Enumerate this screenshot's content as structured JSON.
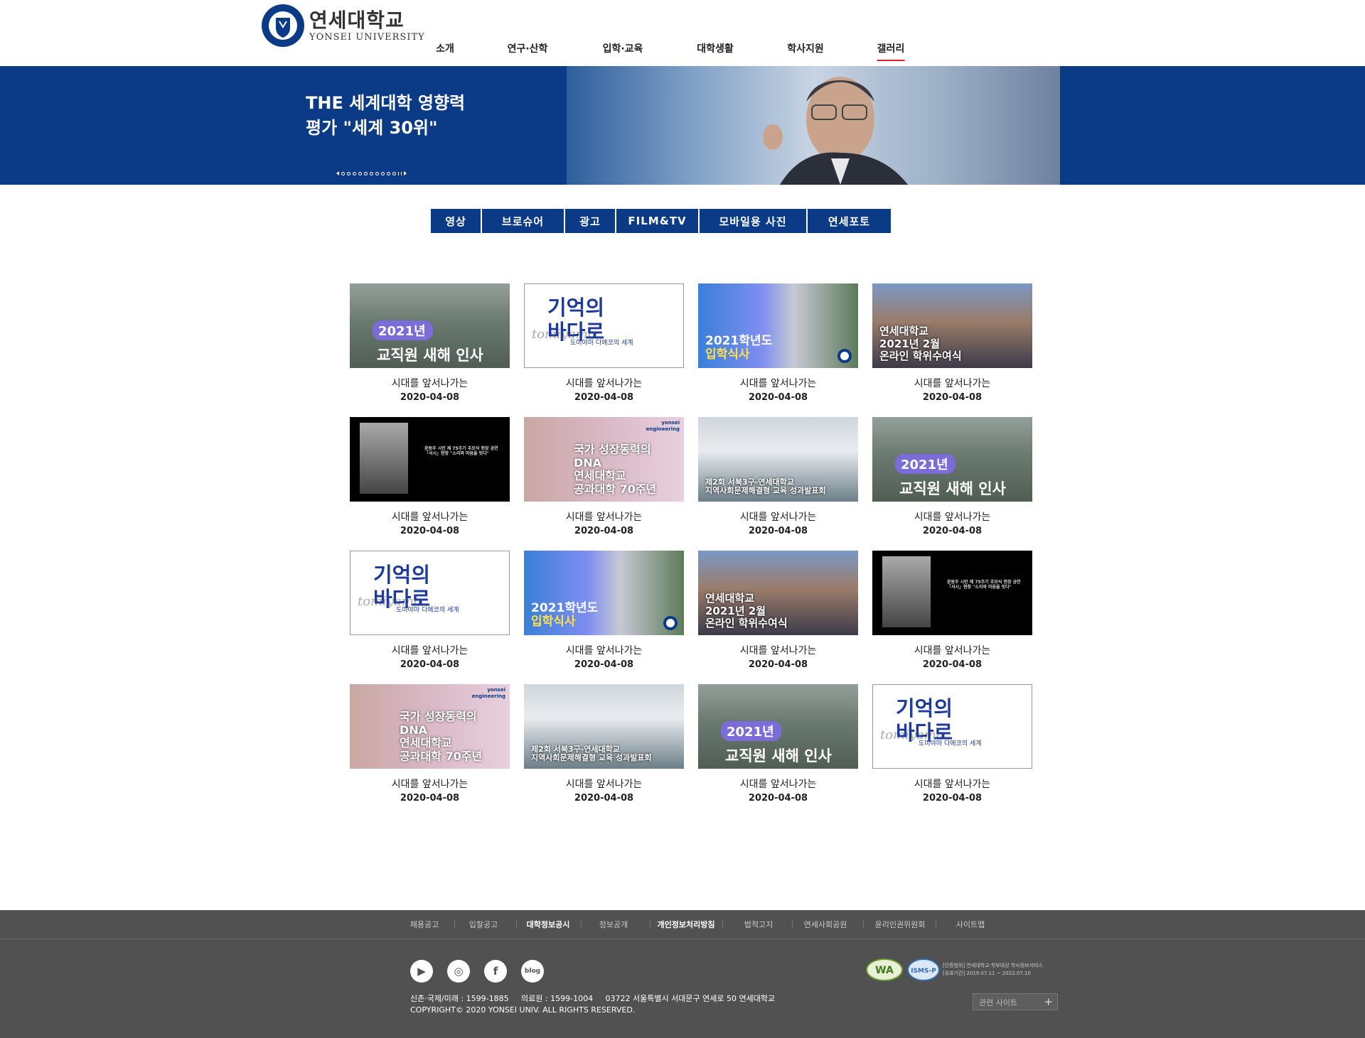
{
  "header": {
    "logo_ko": "연세대학교",
    "logo_en": "YONSEI UNIVERSITY",
    "nav": [
      {
        "label": "소개"
      },
      {
        "label": "연구·산학"
      },
      {
        "label": "입학·교육"
      },
      {
        "label": "대학생활"
      },
      {
        "label": "학사지원"
      },
      {
        "label": "갤러리",
        "active": true
      }
    ]
  },
  "banner": {
    "title": "THE 세계대학 영향력\n평가 \"세계 30위\"",
    "slide_count": 10
  },
  "tabs": [
    "영상",
    "브로슈어",
    "광고",
    "FILM&TV",
    "모바일용 사진",
    "연세포토"
  ],
  "gallery": {
    "items": [
      {
        "type": "campus",
        "year": "2021년",
        "thumb_text": "교직원 새해 인사",
        "title": "시대를 앞서나가는",
        "date": "2020-04-08"
      },
      {
        "type": "memory",
        "thumb_text": "기억의\n바다로",
        "sub": "도미야마 다에코의 세계",
        "script": "tomiyama",
        "title": "시대를 앞서나가는",
        "date": "2020-04-08"
      },
      {
        "type": "admit",
        "thumb_text": "2021학년도",
        "highlight": "입학식사",
        "title": "시대를 앞서나가는",
        "date": "2020-04-08"
      },
      {
        "type": "grad",
        "thumb_text": "연세대학교\n2021년 2월\n온라인 학위수여식",
        "title": "시대를 앞서나가는",
        "date": "2020-04-08"
      },
      {
        "type": "dark",
        "thumb_text": "윤동주 시인 제 75주기 추모식 현장 공연\n「서시」현창 \"소리와 마음을 잇다\"",
        "title": "시대를 앞서나가는",
        "date": "2020-04-08"
      },
      {
        "type": "eng",
        "badge": "yonsei\nengineering",
        "thumb_text": "국가 성장동력의 DNA\n연세대학교\n공과대학 70주년",
        "title": "시대를 앞서나가는",
        "date": "2020-04-08"
      },
      {
        "type": "shake",
        "thumb_text": "제2회 서북3구-연세대학교\n지역사회문제해결형 교육 성과발표회",
        "title": "시대를 앞서나가는",
        "date": "2020-04-08"
      },
      {
        "type": "campus",
        "year": "2021년",
        "thumb_text": "교직원 새해 인사",
        "title": "시대를 앞서나가는",
        "date": "2020-04-08"
      },
      {
        "type": "memory",
        "thumb_text": "기억의\n바다로",
        "sub": "도미야마 다에코의 세계",
        "script": "tomiyama",
        "title": "시대를 앞서나가는",
        "date": "2020-04-08"
      },
      {
        "type": "admit",
        "thumb_text": "2021학년도",
        "highlight": "입학식사",
        "title": "시대를 앞서나가는",
        "date": "2020-04-08"
      },
      {
        "type": "grad",
        "thumb_text": "연세대학교\n2021년 2월\n온라인 학위수여식",
        "title": "시대를 앞서나가는",
        "date": "2020-04-08"
      },
      {
        "type": "dark",
        "thumb_text": "윤동주 시인 제 75주기 추모식 현장 공연\n「서시」현창 \"소리와 마음을 잇다\"",
        "title": "시대를 앞서나가는",
        "date": "2020-04-08"
      },
      {
        "type": "eng",
        "badge": "yonsei\nengineering",
        "thumb_text": "국가 성장동력의 DNA\n연세대학교\n공과대학 70주년",
        "title": "시대를 앞서나가는",
        "date": "2020-04-08"
      },
      {
        "type": "shake",
        "thumb_text": "제2회 서북3구-연세대학교\n지역사회문제해결형 교육 성과발표회",
        "title": "시대를 앞서나가는",
        "date": "2020-04-08"
      },
      {
        "type": "campus",
        "year": "2021년",
        "thumb_text": "교직원 새해 인사",
        "title": "시대를 앞서나가는",
        "date": "2020-04-08"
      },
      {
        "type": "memory",
        "thumb_text": "기억의\n바다로",
        "sub": "도미야마 다에코의 세계",
        "script": "tomiyama",
        "title": "시대를 앞서나가는",
        "date": "2020-04-08"
      }
    ]
  },
  "footer": {
    "links": [
      {
        "label": "채용공고",
        "bold": false
      },
      {
        "label": "입찰공고",
        "bold": false
      },
      {
        "label": "대학정보공시",
        "bold": true
      },
      {
        "label": "정보공개",
        "bold": false
      },
      {
        "label": "개인정보처리방침",
        "bold": true
      },
      {
        "label": "법적고지",
        "bold": false
      },
      {
        "label": "연세사회공원",
        "bold": false
      },
      {
        "label": "윤리인권위원회",
        "bold": false
      },
      {
        "label": "사이트맵",
        "bold": false
      }
    ],
    "social": [
      {
        "icon": "youtube-icon",
        "glyph": "▶"
      },
      {
        "icon": "instagram-icon",
        "glyph": "◎"
      },
      {
        "icon": "facebook-icon",
        "glyph": "f"
      },
      {
        "icon": "blog-icon",
        "glyph": "blog"
      }
    ],
    "address_line": "신촌·국제/미래 : 1599-1885     의료원 : 1599-1004     03722 서울특별시 서대문구 연세로 50 연세대학교",
    "copyright": "COPYRIGHT© 2020 YONSEI UNIV. ALL RIGHTS RESERVED.",
    "cert_badges": [
      "WA",
      "ISMS-P"
    ],
    "cert_line1": "[인증범위] 연세대학교 학부대상 학사정보서비스",
    "cert_line2": "[유효기간] 2019.07.11 ~ 2022.07.10",
    "related_sites": "관련 사이트"
  },
  "colors": {
    "primary": "#0b3a87",
    "active_underline": "#e0232a",
    "footer_bg": "#515151"
  }
}
